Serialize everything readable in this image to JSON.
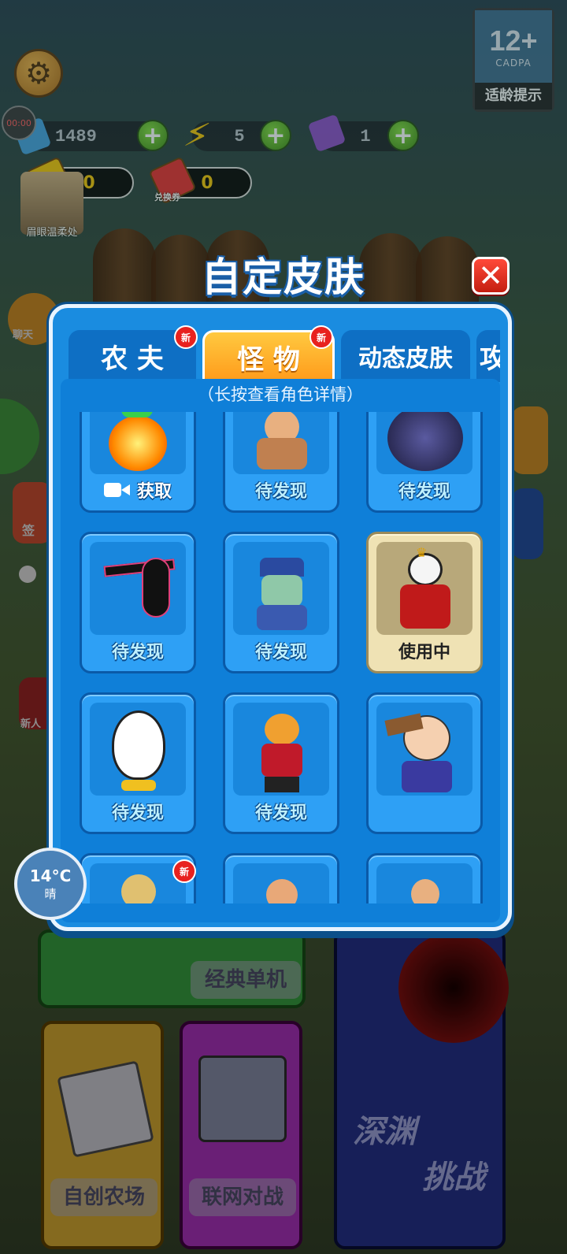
{
  "hud": {
    "timer": "00:00",
    "coins": "1489",
    "energy": "5",
    "tickets": "1",
    "gold_ticket_count": "0",
    "exchange_ticket_count": "0",
    "exchange_ticket_label": "兑换券",
    "avatar_name": "眉眼温柔处",
    "rating_age": "12+",
    "rating_org": "CADPA",
    "rating_label": "适龄提示"
  },
  "modal": {
    "title": "自定皮肤",
    "close_label": "✕",
    "hint": "（长按查看角色详情）",
    "new_badge": "新",
    "tabs": [
      {
        "label": "农 夫",
        "active": false,
        "is_new": true
      },
      {
        "label": "怪 物",
        "active": true,
        "is_new": true
      },
      {
        "label": "动态皮肤",
        "active": false,
        "is_new": false
      },
      {
        "label": "攻",
        "active": false,
        "is_new": false
      }
    ],
    "cards": [
      {
        "status": "获取",
        "type": "video",
        "art": "fire-monster"
      },
      {
        "status": "待发现",
        "type": "locked",
        "art": "running-villager"
      },
      {
        "status": "待发现",
        "type": "locked",
        "art": "storm-cloud"
      },
      {
        "status": "待发现",
        "type": "locked",
        "art": "shadow-stickman"
      },
      {
        "status": "待发现",
        "type": "locked",
        "art": "jiangshi-zombie"
      },
      {
        "status": "使用中",
        "type": "in-use",
        "art": "panda-king"
      },
      {
        "status": "待发现",
        "type": "locked",
        "art": "egg-man"
      },
      {
        "status": "待发现",
        "type": "locked",
        "art": "nine-tail-boy"
      },
      {
        "status": "",
        "type": "unlocked",
        "art": "sailor-sign"
      },
      {
        "status": "",
        "type": "partial",
        "art": "armored-hero",
        "is_new": true
      },
      {
        "status": "",
        "type": "partial",
        "art": "angry-man"
      },
      {
        "status": "",
        "type": "partial",
        "art": "caped-man"
      }
    ]
  },
  "weather": {
    "temp": "14°C",
    "condition": "晴"
  },
  "modes": {
    "classic": "经典单机",
    "create_farm": "自创农场",
    "online_battle": "联网对战",
    "abyss_line1": "深渊",
    "abyss_line2": "挑战"
  },
  "side": {
    "chat": "聊天",
    "sign": "签",
    "gift": "新人"
  },
  "colors": {
    "panel_blue": "#1a8ce0",
    "active_tab": "#ff9a1a",
    "close_red": "#e8211e",
    "in_use_card": "#efe2b4"
  }
}
